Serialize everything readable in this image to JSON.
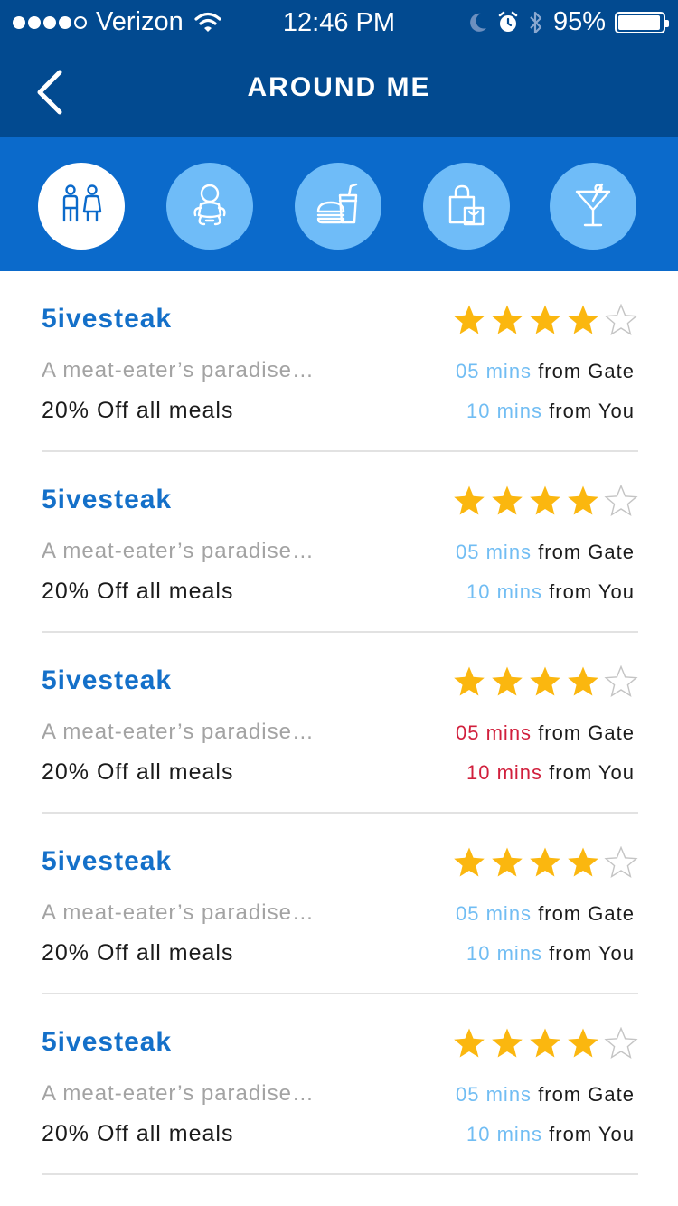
{
  "status_bar": {
    "carrier": "Verizon",
    "time": "12:46 PM",
    "battery_percent": "95%",
    "battery_level": 0.95,
    "signal_bars_filled": 4,
    "signal_bars_total": 5
  },
  "nav": {
    "title": "AROUND ME",
    "back_icon": "chevron-left-icon"
  },
  "categories": [
    {
      "icon": "restroom-icon",
      "active": true
    },
    {
      "icon": "baby-icon",
      "active": false
    },
    {
      "icon": "food-drink-icon",
      "active": false
    },
    {
      "icon": "shopping-bag-icon",
      "active": false
    },
    {
      "icon": "cocktail-icon",
      "active": false
    }
  ],
  "colors": {
    "header_blue": "#024a90",
    "category_bar_blue": "#0b6acb",
    "category_circle": "#6fbcf8",
    "title_blue": "#1470c9",
    "mins_normal": "#71bdf3",
    "mins_alert": "#d11f3c",
    "star_gold": "#fbb70f"
  },
  "items": [
    {
      "name": "5ivesteak",
      "description": "A meat-eater’s paradise…",
      "deal": "20% Off all meals",
      "rating": 4,
      "max_rating": 5,
      "gate_mins": "05 mins",
      "gate_label": "from Gate",
      "you_mins": "10 mins",
      "you_label": "from You",
      "alert": false
    },
    {
      "name": "5ivesteak",
      "description": "A meat-eater’s paradise…",
      "deal": "20% Off all meals",
      "rating": 4,
      "max_rating": 5,
      "gate_mins": "05 mins",
      "gate_label": "from Gate",
      "you_mins": "10 mins",
      "you_label": "from You",
      "alert": false
    },
    {
      "name": "5ivesteak",
      "description": "A meat-eater’s paradise…",
      "deal": "20% Off all meals",
      "rating": 4,
      "max_rating": 5,
      "gate_mins": "05 mins",
      "gate_label": "from Gate",
      "you_mins": "10 mins",
      "you_label": "from You",
      "alert": true
    },
    {
      "name": "5ivesteak",
      "description": "A meat-eater’s paradise…",
      "deal": "20% Off all meals",
      "rating": 4,
      "max_rating": 5,
      "gate_mins": "05 mins",
      "gate_label": "from Gate",
      "you_mins": "10 mins",
      "you_label": "from You",
      "alert": false
    },
    {
      "name": "5ivesteak",
      "description": "A meat-eater’s paradise…",
      "deal": "20% Off all meals",
      "rating": 4,
      "max_rating": 5,
      "gate_mins": "05 mins",
      "gate_label": "from Gate",
      "you_mins": "10 mins",
      "you_label": "from You",
      "alert": false
    }
  ]
}
